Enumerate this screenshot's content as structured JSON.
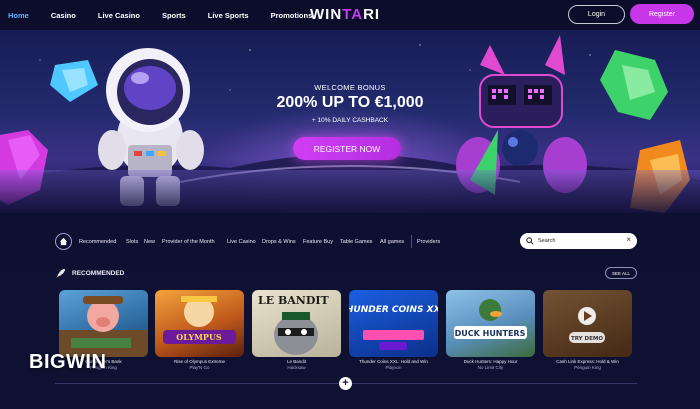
{
  "nav": {
    "items": [
      {
        "label": "Home",
        "active": true
      },
      {
        "label": "Casino",
        "active": false
      },
      {
        "label": "Live Casino",
        "active": false
      },
      {
        "label": "Sports",
        "active": false
      },
      {
        "label": "Live Sports",
        "active": false
      },
      {
        "label": "Promotions",
        "active": false
      }
    ],
    "logo": {
      "part1": "WIN",
      "part2": "TA",
      "part3": "RI"
    },
    "login_label": "Login",
    "register_label": "Register"
  },
  "hero": {
    "kicker": "WELCOME BONUS",
    "headline": "200% UP TO €1,000",
    "sub": "+ 10% DAILY CASHBACK",
    "cta": "REGISTER NOW"
  },
  "filters": {
    "categories": [
      "Recommended",
      "Slots",
      "New",
      "Provider of the Month",
      "Live Casino",
      "Drops & Wins",
      "Feature Buy",
      "Table Games",
      "All games",
      "Providers"
    ],
    "search_placeholder": "Search"
  },
  "recommended": {
    "title": "RECOMMENDED",
    "see_all": "SEE ALL",
    "games": [
      {
        "title": "Gunslinger's Bank",
        "provider": "Penguin King",
        "tile_text": ""
      },
      {
        "title": "Rise of Olympus Extreme",
        "provider": "Play'N Go",
        "tile_text": "OLYMPUS"
      },
      {
        "title": "Le Bandit",
        "provider": "Hacksaw",
        "tile_text": "LE BANDIT"
      },
      {
        "title": "Thunder Coins XXL: Hold and Win",
        "provider": "Playson",
        "tile_text": "THUNDER COINS XXL"
      },
      {
        "title": "Duck Hunters: Happy Hour",
        "provider": "No Limit City",
        "tile_text": "DUCK HUNTERS"
      },
      {
        "title": "Cash Link Express: Hold & Win",
        "provider": "Penguin King",
        "tile_text": "TRY DEMO"
      }
    ]
  },
  "watermark": "BIGWIN",
  "colors": {
    "accent": "#c737e8",
    "nav_active": "#59b6ff",
    "bg": "#0f1132"
  }
}
